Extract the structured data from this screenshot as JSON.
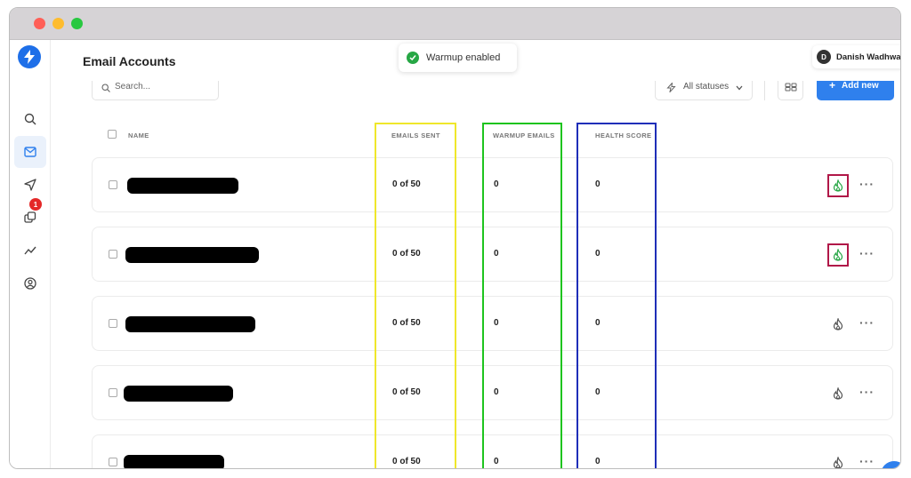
{
  "window": {
    "controls": [
      "close",
      "minimize",
      "maximize"
    ]
  },
  "sidebar": {
    "items": [
      {
        "name": "search-icon",
        "active": false
      },
      {
        "name": "mail-icon",
        "active": true
      },
      {
        "name": "send-icon",
        "active": false
      },
      {
        "name": "copy-icon",
        "active": false,
        "badge": "1"
      },
      {
        "name": "analytics-icon",
        "active": false
      },
      {
        "name": "profile-icon",
        "active": false
      }
    ]
  },
  "header": {
    "title": "Email Accounts"
  },
  "toast": {
    "text": "Warmup enabled"
  },
  "user": {
    "initial": "D",
    "name": "Danish Wadhwa"
  },
  "toolbar": {
    "search_placeholder": "Search...",
    "status_filter": "All statuses",
    "add_label": "Add new",
    "add_plus": "+"
  },
  "table": {
    "headers": {
      "name": "Name",
      "emails_sent": "Emails Sent",
      "warmup_emails": "Warmup Emails",
      "health_score": "Health Score"
    },
    "rows": [
      {
        "emails_sent": "0 of 50",
        "warmup_emails": "0",
        "health_score": "0",
        "warmup_enabled": true
      },
      {
        "emails_sent": "0 of 50",
        "warmup_emails": "0",
        "health_score": "0",
        "warmup_enabled": true
      },
      {
        "emails_sent": "0 of 50",
        "warmup_emails": "0",
        "health_score": "0",
        "warmup_enabled": false
      },
      {
        "emails_sent": "0 of 50",
        "warmup_emails": "0",
        "health_score": "0",
        "warmup_enabled": false
      },
      {
        "emails_sent": "0 of 50",
        "warmup_emails": "0",
        "health_score": "0",
        "warmup_enabled": false
      }
    ]
  },
  "colors": {
    "accent": "#2f80ed",
    "warmup_on": "#27a745",
    "highlight": "#b01848",
    "emails_sent_box": "#efe72b",
    "warmup_box": "#1ec41e",
    "health_box": "#1f2eb8"
  }
}
